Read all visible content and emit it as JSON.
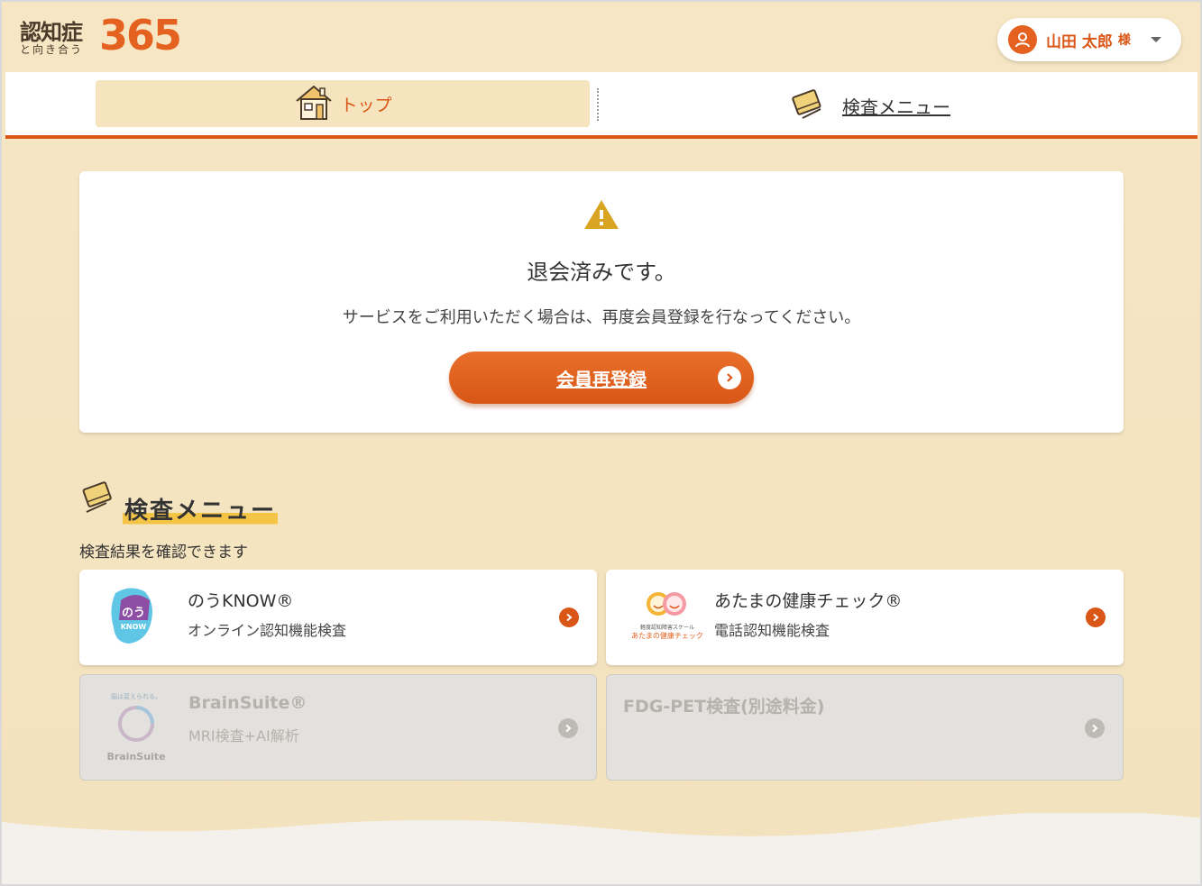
{
  "header": {
    "logo_main": "認知症",
    "logo_sub": "と向き合う",
    "logo_number": "365",
    "user_name": "山田 太郎",
    "user_suffix": "様"
  },
  "nav": {
    "tabs": [
      {
        "label": "トップ",
        "icon": "house-icon",
        "active": true
      },
      {
        "label": "検査メニュー",
        "icon": "notebook-icon",
        "active": false
      }
    ]
  },
  "notice": {
    "icon": "warning-icon",
    "title": "退会済みです。",
    "text": "サービスをご利用いただく場合は、再度会員登録を行なってください。",
    "button_label": "会員再登録"
  },
  "exam_menu": {
    "title": "検査メニュー",
    "subtitle": "検査結果を確認できます",
    "cards": [
      {
        "title": "のうKNOW®",
        "subtitle": "オンライン認知機能検査",
        "logo_text_1": "のう",
        "logo_text_2": "KNOW",
        "disabled": false
      },
      {
        "title": "あたまの健康チェック®",
        "subtitle": "電話認知機能検査",
        "logo_text_1": "軽度認知障害スケール",
        "logo_text_2": "あたまの健康チェック",
        "disabled": false
      },
      {
        "title": "BrainSuite®",
        "subtitle": "MRI検査+AI解析",
        "logo_text_1": "脳は変えられる。",
        "logo_text_2": "BrainSuite",
        "disabled": true
      },
      {
        "title": "FDG-PET検査(別途料金)",
        "subtitle": "",
        "disabled": true
      }
    ]
  },
  "colors": {
    "accent": "#d95616",
    "background": "#f3e3be",
    "highlight": "#f3c445"
  }
}
